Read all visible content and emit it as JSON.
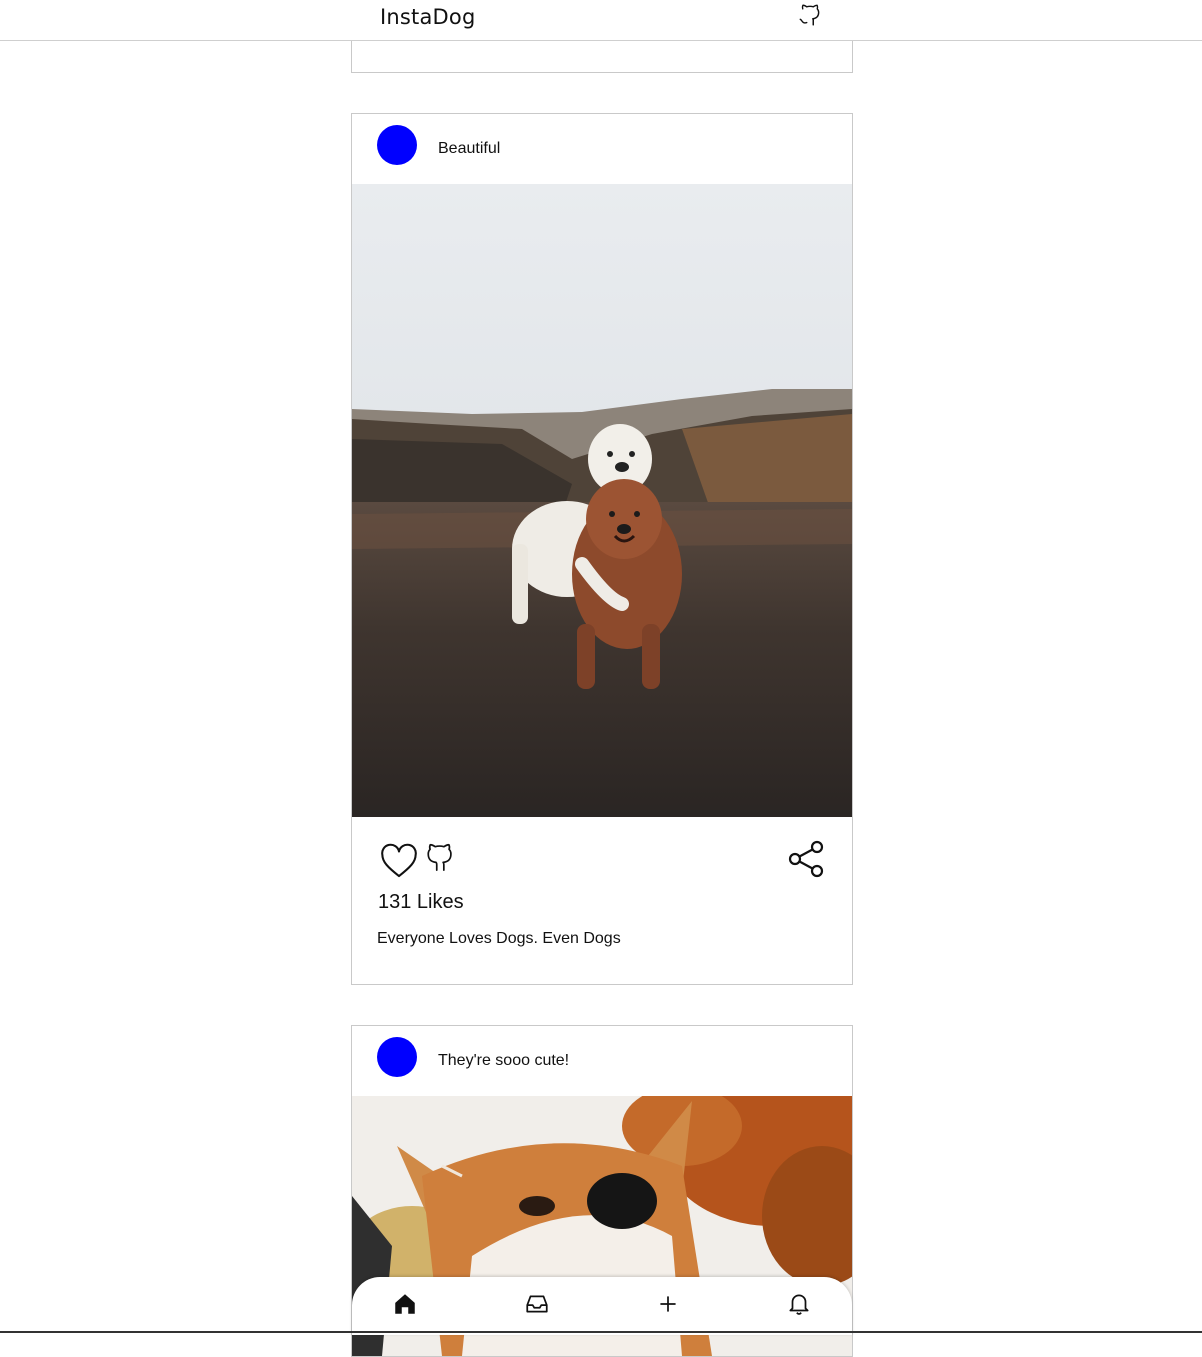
{
  "app": {
    "brand": "InstaDog",
    "icons": {
      "github": "github-icon"
    }
  },
  "posts": [
    {
      "title": "Beautiful",
      "avatar_color": "#0000ff",
      "likes": "131 Likes",
      "caption": "Everyone Loves Dogs. Even Dogs",
      "icons": [
        "heart-icon",
        "github-icon",
        "share-icon"
      ]
    },
    {
      "title": "They're sooo cute!",
      "avatar_color": "#0000ff"
    }
  ],
  "bottom_nav": {
    "items": [
      "home-icon",
      "inbox-icon",
      "plus-icon",
      "bell-icon"
    ]
  }
}
